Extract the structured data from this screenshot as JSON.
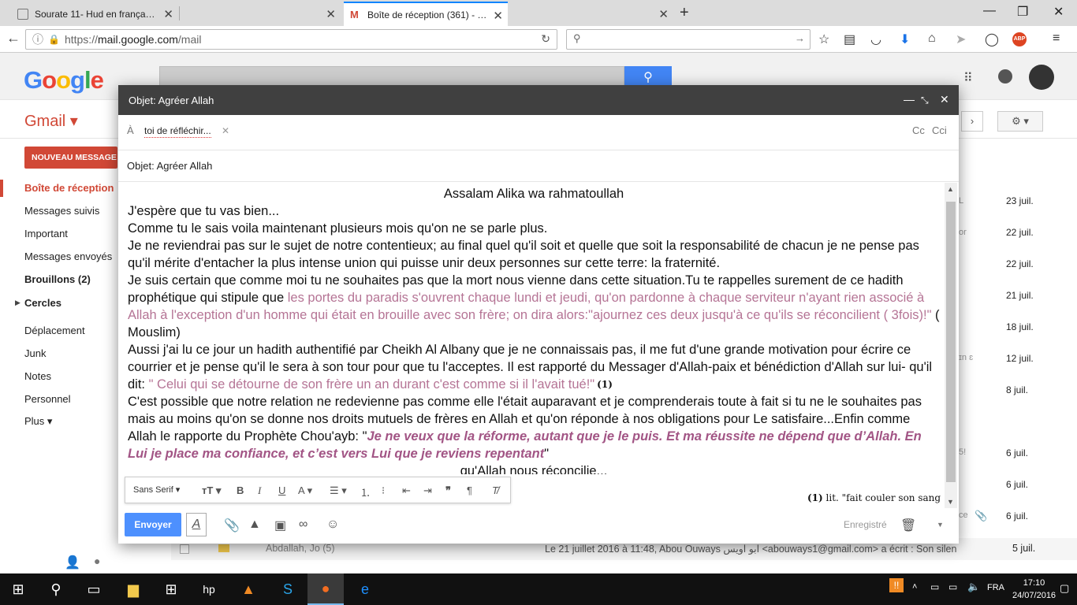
{
  "browser": {
    "tabs": [
      {
        "label": "Sourate 11- Hud en françа…",
        "active": false
      },
      {
        "label": "",
        "active": false
      },
      {
        "label": "Boîte de réception (361) - …",
        "active": true
      }
    ],
    "url": {
      "scheme": "https://",
      "host": "mail.google.com",
      "path": "/mail"
    },
    "extension_badge": "ABP"
  },
  "gmail": {
    "logo": "Google",
    "app_label": "Gmail ▾",
    "compose_label": "NOUVEAU MESSAGE",
    "nav": [
      {
        "label": "Boîte de réception",
        "selected": true
      },
      {
        "label": "Messages suivis"
      },
      {
        "label": "Important"
      },
      {
        "label": "Messages envoyés"
      },
      {
        "label": "Brouillons (2)",
        "bold": true
      },
      {
        "label": "Cercles",
        "bold": true
      },
      {
        "label": "Déplacement"
      },
      {
        "label": "Junk"
      },
      {
        "label": "Notes"
      },
      {
        "label": "Personnel"
      },
      {
        "label": "Plus ▾"
      }
    ],
    "mail_dates": [
      "23 juil.",
      "22 juil.",
      "22 juil.",
      "21 juil.",
      "18 juil.",
      "12 juil.",
      "8 juil.",
      "6 juil.",
      "6 juil.",
      "6 juil.",
      "5 juil."
    ],
    "bottom_row": {
      "sender": "Abdallah, Jo (5)",
      "snippet": "Le 21 juillet 2016 à 11:48, Abou Ouways ابو اويس <abouways1@gmail.com> a écrit : Son silen",
      "date": "5 juil."
    }
  },
  "compose": {
    "window_title": "Objet: Agréer Allah",
    "to_label": "À",
    "to_chip": "toi de réfléchir...",
    "cc": "Cc",
    "bcc": "Cci",
    "subject": "Objet: Agréer Allah",
    "body": {
      "greeting": "Assalam Alika wa rahmatoullah",
      "l1": "J'espère que tu vas bien...",
      "l2": "Comme tu le sais voila maintenant plusieurs mois qu'on ne se parle plus.",
      "l3": "Je ne reviendrai pas sur le sujet de notre contentieux; au final quel qu'il soit et quelle que soit la responsabilité  de chacun je ne pense pas qu'il  mérite  d'entacher la plus intense union qui puisse unir deux personnes sur cette terre: la fraternité.",
      "l4a": "Je suis certain que comme moi tu ne souhaites pas que la mort nous vienne dans cette situation.Tu te rappelles surement de ce hadith prophétique qui stipule  que ",
      "l4b": "les portes du paradis s'ouvrent chaque lundi et jeudi, qu'on pardonne à chaque serviteur n'ayant rien associé à Allah à l'exception d'un homme qui était en brouille avec son frère; on dira alors:\"ajournez ces deux jusqu'à ce qu'ils se réconcilient ( 3fois)!\"",
      "l4c": " ( Mouslim)",
      "l5a": "Aussi j'ai lu ce jour un hadith authentifié par Cheikh Al Albany que je ne connaissais pas, il me fut d'une grande motivation pour écrire ce courrier et je pense qu'il le sera à son tour pour que tu l'acceptes. Il est rapporté du Messager d'Allah-paix et bénédiction d'Allah sur lui- qu'il dit: ",
      "l5b": "\" Celui qui se détourne de son frère un an durant c'est comme si il l'avait tué!\"",
      "l5c": "(1)",
      "l6a": "C'est possible que notre relation ne redevienne pas comme elle l'était auparavant et je comprenderais toute à fait si tu ne le souhaites pas mais au moins qu'on se donne nos droits mutuels de frères en Allah et qu'on réponde à nos obligations pour Le satisfaire...Enfin comme Allah le rapporte du Prophète Chou'ayb: \"",
      "l6b": "Je ne veux que la réforme, autant que je le puis. Et ma réussite ne dépend que d’Allah. En Lui je place ma confiance, et c’est vers Lui que je reviens repentant",
      "l6c": "\"",
      "l7": "qu'Allah nous réconcilie...",
      "footnote_num": "(1)",
      "footnote": " lit. \"fait couler son sang"
    },
    "format_bar": {
      "font": "Sans Serif"
    },
    "send_label": "Envoyer",
    "saved_label": "Enregistré"
  },
  "taskbar": {
    "lang": "FRA",
    "time": "17:10",
    "date": "24/07/2016"
  }
}
